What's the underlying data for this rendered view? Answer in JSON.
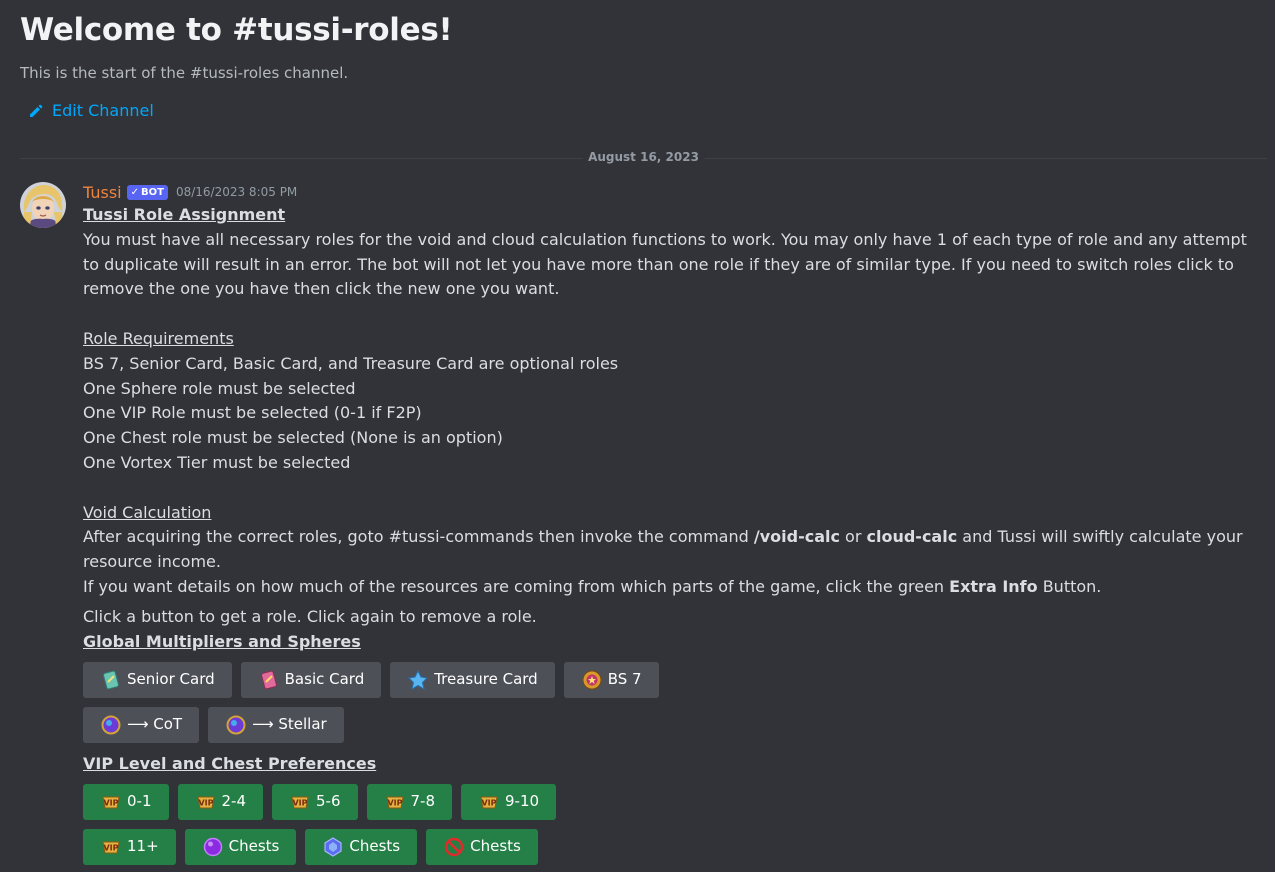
{
  "channel": {
    "welcome_title": "Welcome to #tussi-roles!",
    "welcome_subtitle": "This is the start of the #tussi-roles channel.",
    "edit_channel_label": "Edit Channel"
  },
  "divider": {
    "date": "August 16, 2023"
  },
  "message": {
    "author": "Tussi",
    "bot_tag": "BOT",
    "timestamp": "08/16/2023 8:05 PM",
    "title": "Tussi Role Assignment",
    "intro": "You must have all necessary roles for the void and cloud calculation functions to work. You may only have 1 of each type of role and any attempt to duplicate will result in an error. The bot will not let you have more than one role if they are of similar type. If you need to switch roles click to remove the one you have then click the new one you want.",
    "requirements_heading": "Role Requirements",
    "requirements": [
      "BS 7, Senior Card, Basic Card, and Treasure Card are optional roles",
      "One Sphere role must be selected",
      "One VIP Role must be selected (0-1 if F2P)",
      "One Chest role must be selected (None is an option)",
      "One Vortex Tier must be selected"
    ],
    "void_heading": "Void Calculation",
    "void_text_1": "After acquiring the correct roles, goto #tussi-commands then invoke the command ",
    "void_cmd_1": "/void-calc",
    "void_text_2": " or ",
    "void_cmd_2": "cloud-calc",
    "void_text_3": " and Tussi will swiftly calculate your resource income.",
    "details_text_1": "If you want details on how much of the resources are coming from which parts of the game, click the green ",
    "details_bold": "Extra Info",
    "details_text_2": " Button.",
    "click_text": "Click a button to get a role. Click again to remove a role.",
    "global_heading": "Global Multipliers and Spheres",
    "vip_heading": "VIP Level and Chest Preferences"
  },
  "buttons": {
    "row1": [
      {
        "label": "Senior Card",
        "icon": "senior-card-icon"
      },
      {
        "label": "Basic Card",
        "icon": "basic-card-icon"
      },
      {
        "label": "Treasure Card",
        "icon": "treasure-card-icon"
      },
      {
        "label": "BS 7",
        "icon": "bs7-icon"
      }
    ],
    "row2": [
      {
        "label": "⟶ CoT",
        "icon": "sphere-icon"
      },
      {
        "label": "⟶ Stellar",
        "icon": "sphere-icon"
      }
    ],
    "row3": [
      {
        "label": "0-1",
        "icon": "vip-icon"
      },
      {
        "label": "2-4",
        "icon": "vip-icon"
      },
      {
        "label": "5-6",
        "icon": "vip-icon"
      },
      {
        "label": "7-8",
        "icon": "vip-icon"
      },
      {
        "label": "9-10",
        "icon": "vip-icon"
      }
    ],
    "row4": [
      {
        "label": "11+",
        "icon": "vip-icon"
      },
      {
        "label": "Chests",
        "icon": "purple-chest-icon"
      },
      {
        "label": "Chests",
        "icon": "blue-chest-icon"
      },
      {
        "label": "Chests",
        "icon": "no-entry-icon"
      }
    ]
  },
  "colors": {
    "background": "#313338",
    "username": "#f0823c",
    "link": "#00a8fc",
    "bot_tag": "#5865f2",
    "grey_button": "#4e5058",
    "green_button": "#248046"
  }
}
